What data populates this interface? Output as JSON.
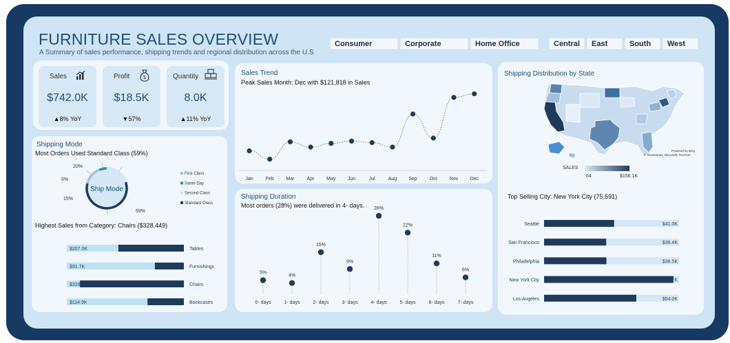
{
  "header": {
    "title": "FURNITURE SALES OVERVIEW",
    "subtitle": "A Summary of sales performance, shipping trends and regional distribution across the U.S"
  },
  "slicers": {
    "segments": [
      "Consumer",
      "Corporate",
      "Home Office"
    ],
    "regions": [
      "Central",
      "East",
      "South",
      "West"
    ]
  },
  "kpis": [
    {
      "label": "Sales",
      "value": "$742.0K",
      "yoy": "▲8% YoY",
      "icon": "sales-chart-icon"
    },
    {
      "label": "Profit",
      "value": "$18.5K",
      "yoy": "▼57%",
      "icon": "money-bag-icon"
    },
    {
      "label": "Quantity",
      "value": "8.0K",
      "yoy": "▲11% YoY",
      "icon": "boxes-icon"
    }
  ],
  "shipping_mode": {
    "title": "Shipping Mode",
    "subtitle": "Most Orders Used Standard Class (59%)",
    "center_label": "Ship Mode"
  },
  "category": {
    "title": "Highest Sales from Category: Chairs ($328,449)"
  },
  "sales_trend": {
    "title": "Sales Trend",
    "subtitle": "Peak Sales Month: Dec with $121,818 in Sales"
  },
  "shipping_duration": {
    "title": "Shipping Duration",
    "subtitle": "Most orders (28%) were delivered in 4- days."
  },
  "map": {
    "title": "Shipping Distribution by State",
    "legend_title": "SALES",
    "legend_min": "64",
    "legend_max": "$156.1K",
    "attribution_1": "Powered by Bing",
    "attribution_2": "© GeoNames, Microsoft, TomTom",
    "colors": {
      "low": "#dbe9f6",
      "high": "#1f3b5c"
    }
  },
  "top_city": {
    "title": "Top Selling City: New York City (75,691)"
  },
  "chart_data": [
    {
      "type": "line",
      "categories": [
        "Jan",
        "Feb",
        "Mar",
        "Apr",
        "May",
        "Jun",
        "Jul",
        "Aug",
        "Sep",
        "Oct",
        "Nov",
        "Dec"
      ],
      "values": [
        46000,
        35000,
        58000,
        51000,
        56000,
        59000,
        57000,
        51000,
        95000,
        63000,
        117000,
        121818
      ]
    },
    {
      "type": "pie",
      "categories": [
        "First Class",
        "Same Day",
        "Second Class",
        "Standard Class"
      ],
      "values": [
        15,
        6,
        20,
        59
      ],
      "labels": [
        "15%",
        "6%",
        "20%",
        "59%"
      ],
      "colors": [
        "#9cc4e4",
        "#2e8bc0",
        "#d6e8f6",
        "#1f3b5c"
      ]
    },
    {
      "type": "bar",
      "categories": [
        "Tables",
        "Furnishings",
        "Chairs",
        "Bookcases"
      ],
      "values": [
        207.0,
        91.7,
        328.4,
        114.9
      ],
      "labels": [
        "$207.0K",
        "$91.7K",
        "$328.4",
        "$114.9K"
      ],
      "xlim": [
        0,
        370
      ]
    },
    {
      "type": "scatter",
      "categories": [
        "0- days",
        "1- days",
        "2- days",
        "3- days",
        "4- days",
        "5- days",
        "6- days",
        "7- days"
      ],
      "values": [
        5,
        4,
        15,
        9,
        28,
        22,
        11,
        6
      ],
      "labels": [
        "5%",
        "4%",
        "15%",
        "9%",
        "28%",
        "22%",
        "11%",
        "6%"
      ]
    },
    {
      "type": "bar",
      "categories": [
        "Seattle",
        "San Francisco",
        "Philadelphia",
        "New York City",
        "Los Angeles"
      ],
      "values": [
        41.0,
        36.4,
        36.5,
        75.7,
        54.0
      ],
      "labels": [
        "$41.0K",
        "$36.4K",
        "$36.5K",
        "$75.7K",
        "$54.0K"
      ],
      "xlim": [
        0,
        79
      ]
    }
  ]
}
